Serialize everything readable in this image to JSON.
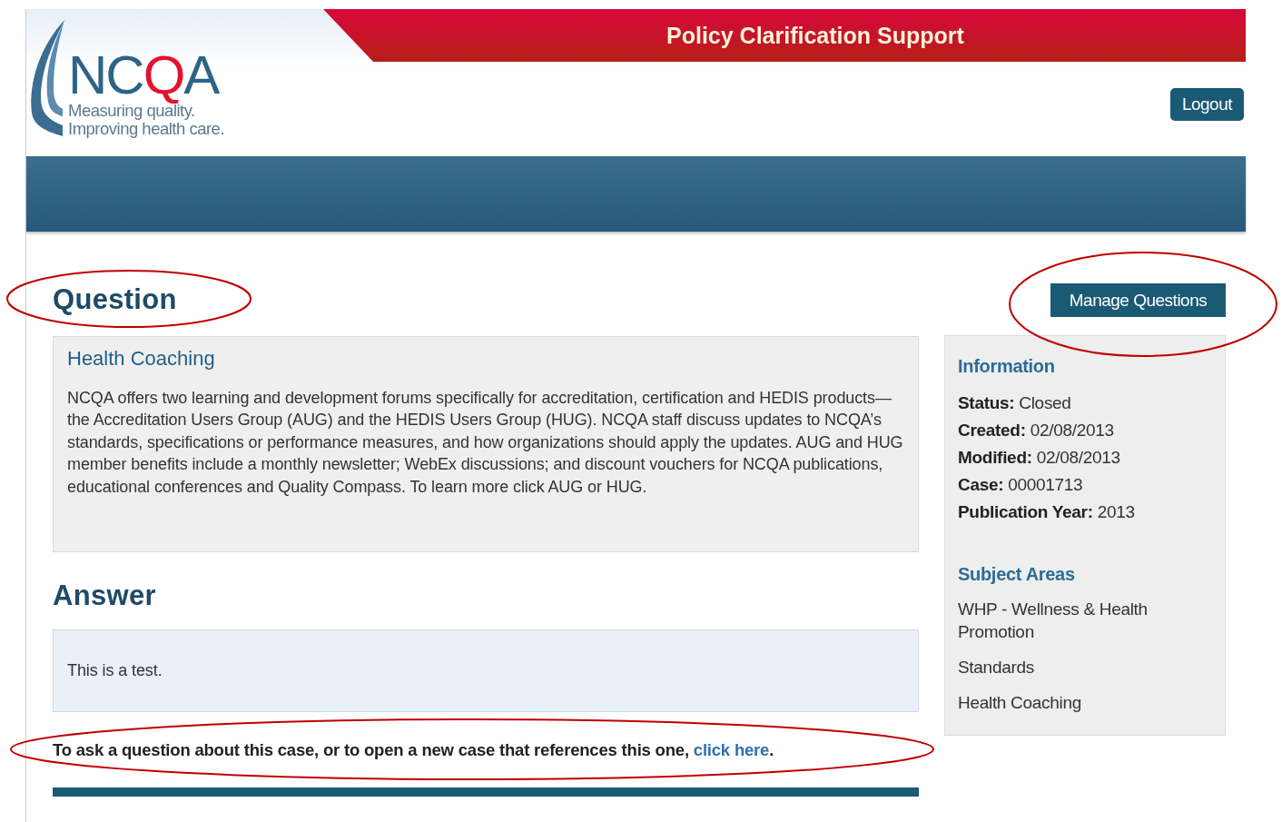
{
  "header": {
    "title": "Policy Clarification Support",
    "logo": {
      "wordmark": [
        {
          "text": "NC",
          "accent": false
        },
        {
          "text": "Q",
          "accent": true
        },
        {
          "text": "A",
          "accent": false
        }
      ],
      "tagline": [
        "Measuring quality.",
        "Improving health care."
      ]
    },
    "logout": "Logout"
  },
  "question": {
    "heading": "Question",
    "title": "Health Coaching",
    "body": "NCQA offers two learning and development forums specifically for accreditation, certification and HEDIS products—the Accreditation Users Group (AUG) and the HEDIS Users Group (HUG). NCQA staff discuss updates to NCQA’s standards, specifications or performance measures, and how organizations should apply the updates. AUG and HUG member benefits include a monthly newsletter; WebEx discussions; and discount vouchers for NCQA publications, educational conferences and Quality Compass. To learn more click AUG or HUG."
  },
  "answer": {
    "heading": "Answer",
    "body": "This is a test."
  },
  "footer_note": {
    "text": "To ask a question about this case, or to open a new case that references this one,",
    "link": "click here",
    "end": "."
  },
  "manage_button": "Manage Questions",
  "information": {
    "heading": "Information",
    "fields": [
      {
        "label": "Status:",
        "value": "Closed"
      },
      {
        "label": "Created:",
        "value": "02/08/2013"
      },
      {
        "label": "Modified:",
        "value": "02/08/2013"
      },
      {
        "label": "Case:",
        "value": "00001713"
      },
      {
        "label": "Publication Year:",
        "value": "2013"
      }
    ]
  },
  "subject_areas": {
    "heading": "Subject Areas",
    "items": [
      "WHP - Wellness & Health Promotion",
      "Standards",
      "Health Coaching"
    ]
  }
}
